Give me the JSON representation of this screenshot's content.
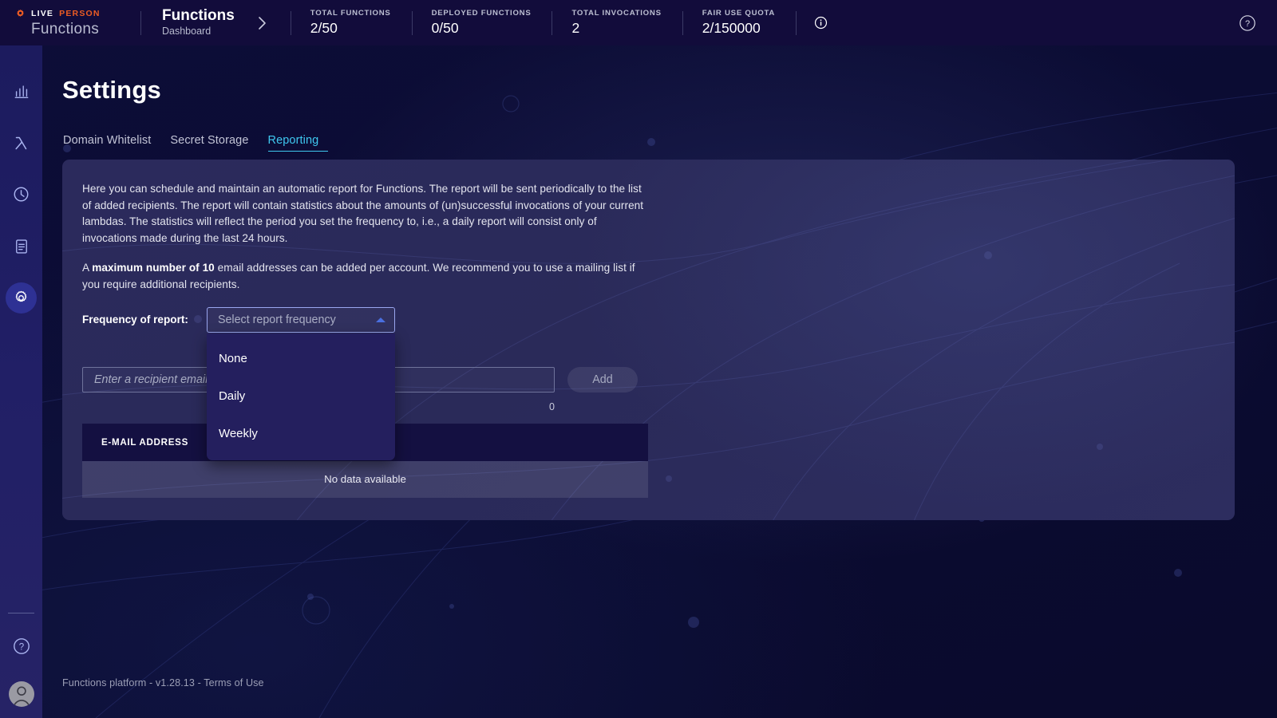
{
  "brand": {
    "logo_icon": "gear-logo-icon",
    "word_live": "LIVE",
    "word_person": "PERSON",
    "product": "Functions"
  },
  "header": {
    "breadcrumb_title": "Functions",
    "breadcrumb_sub": "Dashboard",
    "chevron_icon": "chevron-right-icon",
    "info_icon": "info-circle-icon",
    "help_icon": "question-circle-icon",
    "stats": [
      {
        "label": "TOTAL FUNCTIONS",
        "value": "2/50"
      },
      {
        "label": "DEPLOYED FUNCTIONS",
        "value": "0/50"
      },
      {
        "label": "TOTAL INVOCATIONS",
        "value": "2"
      },
      {
        "label": "FAIR USE QUOTA",
        "value": "2/150000"
      }
    ]
  },
  "sidebar": {
    "items": [
      {
        "name": "sidebar-item-dashboard",
        "icon": "bar-chart-icon",
        "active": false
      },
      {
        "name": "sidebar-item-functions",
        "icon": "lambda-icon",
        "active": false
      },
      {
        "name": "sidebar-item-history",
        "icon": "clock-icon",
        "active": false
      },
      {
        "name": "sidebar-item-logs",
        "icon": "document-icon",
        "active": false
      },
      {
        "name": "sidebar-item-settings",
        "icon": "gear-icon",
        "active": true
      }
    ],
    "help_icon": "question-circle-icon",
    "avatar_icon": "user-avatar-icon"
  },
  "main": {
    "page_title": "Settings",
    "tabs": [
      {
        "label": "Domain Whitelist",
        "active": false
      },
      {
        "label": "Secret Storage",
        "active": false
      },
      {
        "label": "Reporting",
        "active": true
      }
    ],
    "paragraph_1": "Here you can schedule and maintain an automatic report for Functions. The report will be sent periodically to the list of added recipients. The report will contain statistics about the amounts of (un)successful invocations of your current lambdas. The statistics will reflect the period you set the frequency to, i.e., a daily report will consist only of invocations made during the last 24 hours.",
    "paragraph_2_pre": "A ",
    "paragraph_2_bold": "maximum number of 10",
    "paragraph_2_post": " email addresses can be added per account. We recommend you to use a mailing list if you require additional recipients.",
    "frequency_label": "Frequency of report:",
    "select": {
      "placeholder": "Select report frequency",
      "value": "",
      "caret_icon": "caret-up-icon",
      "expanded": true,
      "options": [
        "None",
        "Daily",
        "Weekly"
      ]
    },
    "email_input": {
      "placeholder": "Enter a recipient email address",
      "value": ""
    },
    "add_button": "Add",
    "counter": "0",
    "table": {
      "columns": [
        "E-MAIL ADDRESS"
      ],
      "rows": [],
      "empty_text": "No data available"
    }
  },
  "footer": {
    "text": "Functions platform - v1.28.13 - ",
    "terms_link": "Terms of Use"
  },
  "colors": {
    "accent_cyan": "#3fc8f0",
    "brand_orange": "#ed5c23",
    "header_bg": "#120c3b",
    "rail_bg": "#201e64",
    "card_bg": "#2b2a5c",
    "table_header_bg": "#141041",
    "dropdown_bg": "#241f5e"
  }
}
